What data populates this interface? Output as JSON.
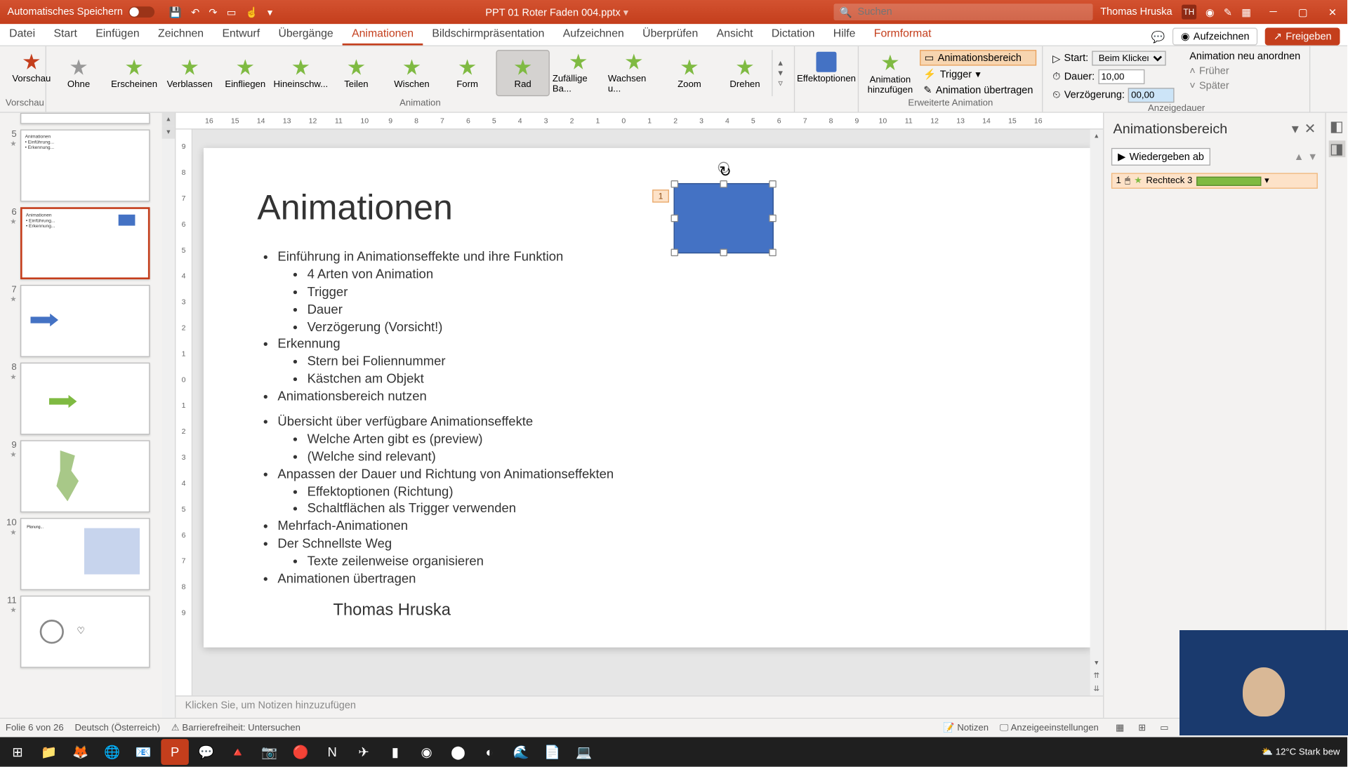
{
  "titlebar": {
    "autosave": "Automatisches Speichern",
    "filename": "PPT 01 Roter Faden 004.pptx",
    "search_placeholder": "Suchen",
    "user": "Thomas Hruska",
    "user_initials": "TH"
  },
  "tabs": {
    "items": [
      "Datei",
      "Start",
      "Einfügen",
      "Zeichnen",
      "Entwurf",
      "Übergänge",
      "Animationen",
      "Bildschirmpräsentation",
      "Aufzeichnen",
      "Überprüfen",
      "Ansicht",
      "Dictation",
      "Hilfe",
      "Formformat"
    ],
    "active": "Animationen",
    "record": "Aufzeichnen",
    "share": "Freigeben"
  },
  "ribbon": {
    "preview": "Vorschau",
    "preview_group": "Vorschau",
    "gallery": [
      "Ohne",
      "Erscheinen",
      "Verblassen",
      "Einfliegen",
      "Hineinschw...",
      "Teilen",
      "Wischen",
      "Form",
      "Rad",
      "Zufällige Ba...",
      "Wachsen u...",
      "Zoom",
      "Drehen"
    ],
    "gallery_selected": "Rad",
    "animation_group": "Animation",
    "effect_options": "Effektoptionen",
    "add_anim": "Animation hinzufügen",
    "anim_pane": "Animationsbereich",
    "trigger": "Trigger",
    "anim_painter": "Animation übertragen",
    "adv_group": "Erweiterte Animation",
    "start_label": "Start:",
    "start_value": "Beim Klicken",
    "duration_label": "Dauer:",
    "duration_value": "10,00",
    "delay_label": "Verzögerung:",
    "delay_value": "00,00",
    "reorder": "Animation neu anordnen",
    "earlier": "Früher",
    "later": "Später",
    "timing_group": "Anzeigedauer"
  },
  "ruler_h": [
    "16",
    "15",
    "14",
    "13",
    "12",
    "11",
    "10",
    "9",
    "8",
    "7",
    "6",
    "5",
    "4",
    "3",
    "2",
    "1",
    "0",
    "1",
    "2",
    "3",
    "4",
    "5",
    "6",
    "7",
    "8",
    "9",
    "10",
    "11",
    "12",
    "13",
    "14",
    "15",
    "16"
  ],
  "ruler_v": [
    "9",
    "8",
    "7",
    "6",
    "5",
    "4",
    "3",
    "2",
    "1",
    "0",
    "1",
    "2",
    "3",
    "4",
    "5",
    "6",
    "7",
    "8",
    "9"
  ],
  "thumbs": [
    "5",
    "6",
    "7",
    "8",
    "9",
    "10",
    "11"
  ],
  "active_slide": "6",
  "slide": {
    "title": "Animationen",
    "author": "Thomas Hruska",
    "bullets": [
      {
        "t": "Einführung in Animationseffekte und ihre Funktion",
        "c": [
          "4 Arten von Animation",
          "Trigger",
          "Dauer",
          "Verzögerung (Vorsicht!)"
        ]
      },
      {
        "t": "Erkennung",
        "c": [
          "Stern bei Foliennummer",
          "Kästchen am Objekt"
        ]
      },
      {
        "t": "Animationsbereich nutzen",
        "c": []
      },
      {
        "t": "",
        "c": []
      },
      {
        "t": "Übersicht über verfügbare Animationseffekte",
        "c": [
          "Welche Arten gibt es (preview)",
          "(Welche sind relevant)"
        ]
      },
      {
        "t": "Anpassen der Dauer und Richtung von Animationseffekten",
        "c": [
          "Effektoptionen (Richtung)",
          "Schaltflächen als Trigger verwenden"
        ]
      },
      {
        "t": "Mehrfach-Animationen",
        "c": []
      },
      {
        "t": "Der Schnellste Weg",
        "c": [
          "Texte zeilenweise organisieren"
        ]
      },
      {
        "t": "Animationen übertragen",
        "c": []
      }
    ],
    "shape_tag": "1"
  },
  "notes_placeholder": "Klicken Sie, um Notizen hinzuzufügen",
  "animpane": {
    "title": "Animationsbereich",
    "play": "Wiedergeben ab",
    "item_index": "1",
    "item_name": "Rechteck 3"
  },
  "status": {
    "slide": "Folie 6 von 26",
    "lang": "Deutsch (Österreich)",
    "access": "Barrierefreiheit: Untersuchen",
    "notes": "Notizen",
    "display": "Anzeigeeinstellungen"
  },
  "taskbar": {
    "weather": "12°C  Stark bew"
  }
}
